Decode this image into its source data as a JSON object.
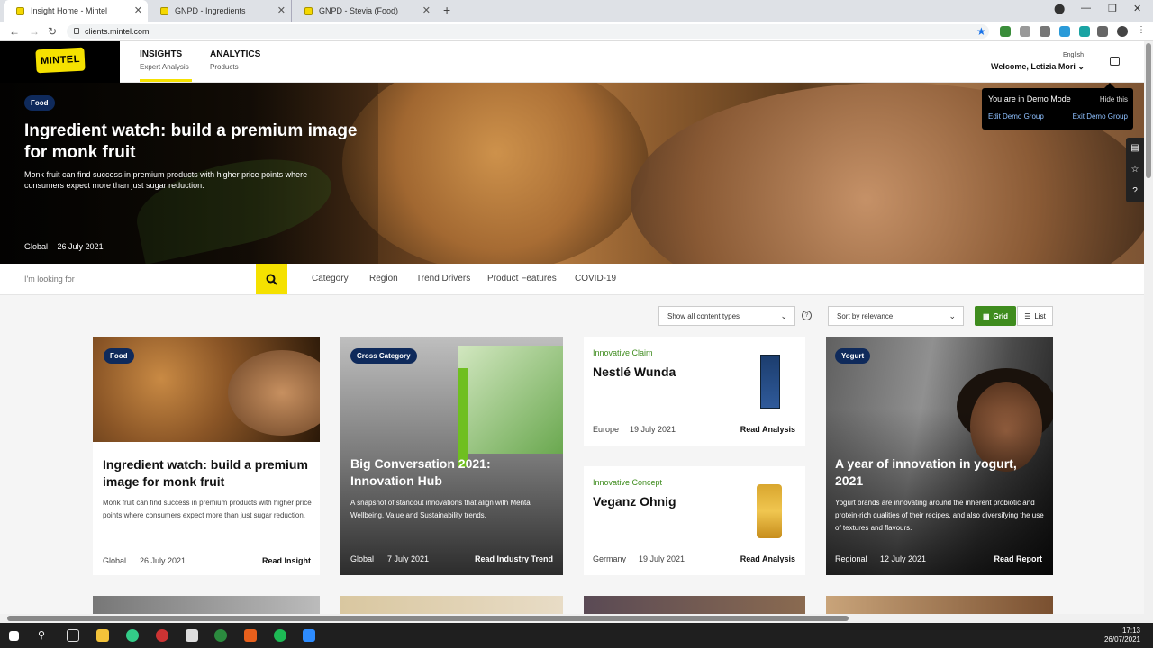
{
  "browser": {
    "tabs": [
      {
        "title": "Insight Home - Mintel"
      },
      {
        "title": "GNPD - Ingredients"
      },
      {
        "title": "GNPD - Stevia (Food)"
      }
    ],
    "url": "clients.mintel.com"
  },
  "header": {
    "logo_text": "MINTEL",
    "nav": [
      {
        "title": "INSIGHTS",
        "subtitle": "Expert Analysis"
      },
      {
        "title": "ANALYTICS",
        "subtitle": "Products"
      }
    ],
    "language": "English",
    "welcome": "Welcome, Letizia Mori"
  },
  "demo": {
    "mode_text": "You are in Demo Mode",
    "hide": "Hide this",
    "edit": "Edit Demo Group",
    "exit": "Exit Demo Group"
  },
  "hero": {
    "badge": "Food",
    "title": "Ingredient watch: build a premium image for monk fruit",
    "desc": "Monk fruit can find success in premium products with higher price points where consumers expect more than just sugar reduction.",
    "region": "Global",
    "date": "26 July 2021"
  },
  "search": {
    "placeholder": "I'm looking for",
    "filters": [
      "Category",
      "Region",
      "Trend Drivers",
      "Product Features",
      "COVID-19"
    ]
  },
  "controls": {
    "content_types": "Show all content types",
    "sort": "Sort by relevance",
    "grid": "Grid",
    "list": "List"
  },
  "cards": {
    "c1": {
      "badge": "Food",
      "title": "Ingredient watch: build a premium image for monk fruit",
      "desc": "Monk fruit can find success in premium products with higher price points where consumers expect more than just sugar reduction.",
      "region": "Global",
      "date": "26 July 2021",
      "cta": "Read Insight"
    },
    "c2": {
      "badge": "Cross Category",
      "title": "Big Conversation 2021: Innovation Hub",
      "desc": "A snapshot of standout innovations that align with Mental Wellbeing, Value and Sustainability trends.",
      "region": "Global",
      "date": "7 July 2021",
      "cta": "Read Industry Trend"
    },
    "c3": {
      "kicker": "Innovative Claim",
      "title": "Nestlé Wunda",
      "region": "Europe",
      "date": "19 July 2021",
      "cta": "Read Analysis"
    },
    "c4": {
      "kicker": "Innovative Concept",
      "title": "Veganz Ohnig",
      "region": "Germany",
      "date": "19 July 2021",
      "cta": "Read Analysis"
    },
    "c5": {
      "badge": "Yogurt",
      "title": "A year of innovation in yogurt, 2021",
      "desc": "Yogurt brands are innovating around the inherent probiotic and protein-rich qualities of their recipes, and also diversifying the use of textures and flavours.",
      "region": "Regional",
      "date": "12 July 2021",
      "cta": "Read Report"
    }
  },
  "taskbar": {
    "time": "17:13",
    "date": "26/07/2021"
  },
  "colors": {
    "brand_yellow": "#f5e100",
    "badge_navy": "#0f2a5b",
    "accent_green": "#3f8c1e"
  }
}
